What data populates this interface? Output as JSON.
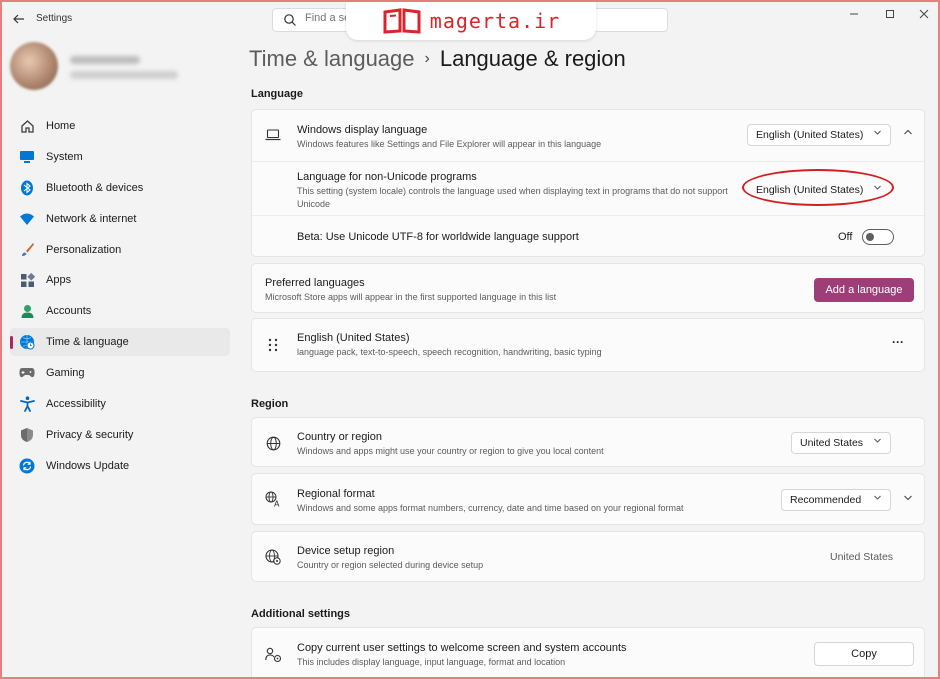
{
  "window": {
    "title": "Settings",
    "search_placeholder": "Find a se",
    "watermark_text": "magerta.ir",
    "accent": "#9e3e78",
    "highlight_color": "#d41f22"
  },
  "sidebar": {
    "items": [
      {
        "label": "Home",
        "icon": "home-icon",
        "color": "#3c3c3c"
      },
      {
        "label": "System",
        "icon": "monitor-icon",
        "color": "#0078d4"
      },
      {
        "label": "Bluetooth & devices",
        "icon": "bluetooth-icon",
        "color": "#0078d4"
      },
      {
        "label": "Network & internet",
        "icon": "wifi-icon",
        "color": "#0078d4"
      },
      {
        "label": "Personalization",
        "icon": "brush-icon",
        "color": "#c96a2a"
      },
      {
        "label": "Apps",
        "icon": "apps-icon",
        "color": "#4a5c75"
      },
      {
        "label": "Accounts",
        "icon": "person-icon",
        "color": "#2aa36b"
      },
      {
        "label": "Time & language",
        "icon": "globe-clock-icon",
        "color": "#0078d4"
      },
      {
        "label": "Gaming",
        "icon": "gamepad-icon",
        "color": "#6c6c6c"
      },
      {
        "label": "Accessibility",
        "icon": "accessibility-icon",
        "color": "#0067c0"
      },
      {
        "label": "Privacy & security",
        "icon": "shield-icon",
        "color": "#6c6c6c"
      },
      {
        "label": "Windows Update",
        "icon": "update-icon",
        "color": "#0078d4"
      }
    ],
    "active_index": 7
  },
  "header": {
    "parent": "Time & language",
    "separator": "›",
    "current": "Language & region"
  },
  "language": {
    "section_label": "Language",
    "display_language": {
      "title": "Windows display language",
      "desc": "Windows features like Settings and File Explorer will appear in this language",
      "value": "English (United States)"
    },
    "non_unicode": {
      "title": "Language for non-Unicode programs",
      "desc": "This setting (system locale) controls the language used when displaying text in programs that do not support Unicode",
      "value": "English (United States)"
    },
    "utf8": {
      "title": "Beta: Use Unicode UTF-8 for worldwide language support",
      "state": "Off"
    },
    "preferred": {
      "title": "Preferred languages",
      "desc": "Microsoft Store apps will appear in the first supported language in this list",
      "add_button": "Add a language"
    },
    "installed": {
      "title": "English (United States)",
      "desc": "language pack, text-to-speech, speech recognition, handwriting, basic typing",
      "more": "···"
    }
  },
  "region": {
    "section_label": "Region",
    "country": {
      "title": "Country or region",
      "desc": "Windows and apps might use your country or region to give you local content",
      "value": "United States"
    },
    "format": {
      "title": "Regional format",
      "desc": "Windows and some apps format numbers, currency, date and time based on your regional format",
      "value": "Recommended"
    },
    "device_setup": {
      "title": "Device setup region",
      "desc": "Country or region selected during device setup",
      "value": "United States"
    }
  },
  "additional": {
    "section_label": "Additional settings",
    "copy": {
      "title": "Copy current user settings to welcome screen and system accounts",
      "desc": "This includes display language, input language, format and location",
      "button": "Copy"
    }
  }
}
